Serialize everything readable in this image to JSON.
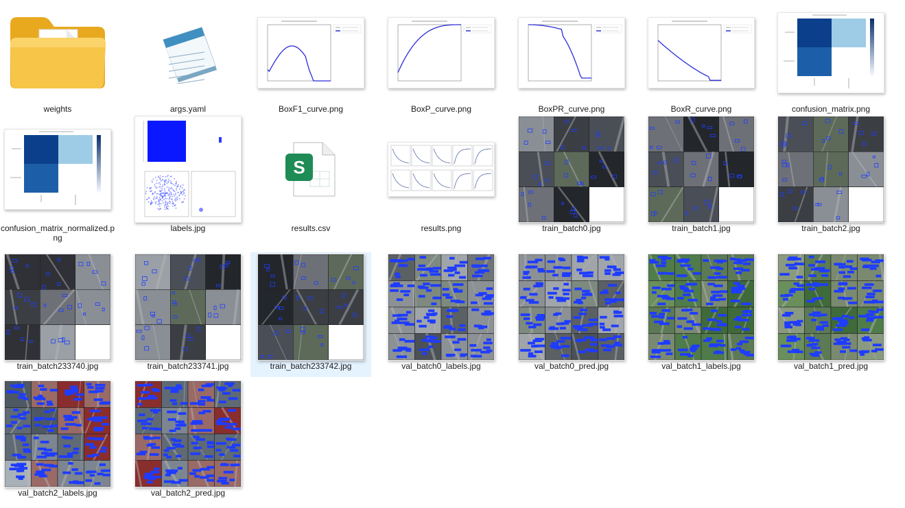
{
  "files": [
    {
      "name": "weights",
      "icon": "folder-icon",
      "kind": "folder"
    },
    {
      "name": "args.yaml",
      "icon": "notepad-icon",
      "kind": "yaml"
    },
    {
      "name": "BoxF1_curve.png",
      "icon": "f1-curve-thumbnail",
      "kind": "curve",
      "curve": "f1"
    },
    {
      "name": "BoxP_curve.png",
      "icon": "precision-curve-thumbnail",
      "kind": "curve",
      "curve": "p"
    },
    {
      "name": "BoxPR_curve.png",
      "icon": "pr-curve-thumbnail",
      "kind": "curve",
      "curve": "pr"
    },
    {
      "name": "BoxR_curve.png",
      "icon": "recall-curve-thumbnail",
      "kind": "curve",
      "curve": "r"
    },
    {
      "name": "confusion_matrix.png",
      "icon": "confusion-matrix-thumbnail",
      "kind": "confusion"
    },
    {
      "name": "confusion_matrix_normalized.png",
      "icon": "confusion-matrix-normalized-thumbnail",
      "kind": "confusion"
    },
    {
      "name": "labels.jpg",
      "icon": "labels-thumbnail",
      "kind": "labels"
    },
    {
      "name": "results.csv",
      "icon": "spreadsheet-icon",
      "kind": "csv"
    },
    {
      "name": "results.png",
      "icon": "results-thumbnail",
      "kind": "results"
    },
    {
      "name": "train_batch0.jpg",
      "icon": "train-batch-thumbnail",
      "kind": "mosaic",
      "variant": "train"
    },
    {
      "name": "train_batch1.jpg",
      "icon": "train-batch-thumbnail",
      "kind": "mosaic",
      "variant": "train"
    },
    {
      "name": "train_batch2.jpg",
      "icon": "train-batch-thumbnail",
      "kind": "mosaic",
      "variant": "train"
    },
    {
      "name": "train_batch233740.jpg",
      "icon": "train-batch-thumbnail",
      "kind": "mosaic",
      "variant": "train"
    },
    {
      "name": "train_batch233741.jpg",
      "icon": "train-batch-thumbnail",
      "kind": "mosaic",
      "variant": "train"
    },
    {
      "name": "train_batch233742.jpg",
      "icon": "train-batch-thumbnail",
      "kind": "mosaic",
      "variant": "train",
      "selected": true
    },
    {
      "name": "val_batch0_labels.jpg",
      "icon": "val-batch-thumbnail",
      "kind": "mosaic",
      "variant": "val"
    },
    {
      "name": "val_batch0_pred.jpg",
      "icon": "val-batch-thumbnail",
      "kind": "mosaic",
      "variant": "val"
    },
    {
      "name": "val_batch1_labels.jpg",
      "icon": "val-batch-thumbnail",
      "kind": "mosaic",
      "variant": "valgreen"
    },
    {
      "name": "val_batch1_pred.jpg",
      "icon": "val-batch-thumbnail",
      "kind": "mosaic",
      "variant": "valgreen"
    },
    {
      "name": "val_batch2_labels.jpg",
      "icon": "val-batch-thumbnail",
      "kind": "mosaic",
      "variant": "valred"
    },
    {
      "name": "val_batch2_pred.jpg",
      "icon": "val-batch-thumbnail",
      "kind": "mosaic",
      "variant": "valred"
    }
  ],
  "colors": {
    "selection": "#e5f3ff",
    "curve": "#2b2bd9",
    "box": "#1f3cff",
    "folder": "#f5c243",
    "spreadsheet": "#1f8c55"
  }
}
